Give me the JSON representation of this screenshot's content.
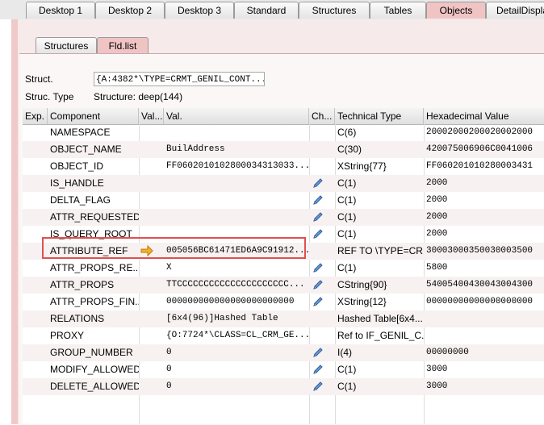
{
  "tabs": [
    {
      "label": "Desktop 1",
      "active": false
    },
    {
      "label": "Desktop 2",
      "active": false
    },
    {
      "label": "Desktop 3",
      "active": false
    },
    {
      "label": "Standard",
      "active": false
    },
    {
      "label": "Structures",
      "active": false
    },
    {
      "label": "Tables",
      "active": false
    },
    {
      "label": "Objects",
      "active": true
    },
    {
      "label": "DetailDisplay",
      "active": false
    }
  ],
  "subtabs": [
    {
      "label": "Structures",
      "active": false
    },
    {
      "label": "Fld.list",
      "active": true
    }
  ],
  "struct": {
    "label": "Struct.",
    "value": "{A:4382*\\TYPE=CRMT_GENIL_CONT...",
    "type_label": "Struc. Type",
    "type_value": "Structure: deep(144)"
  },
  "columns": {
    "exp": "Exp.",
    "component": "Component",
    "valshort": "Val...",
    "val": "Val.",
    "ch": "Ch...",
    "techtype": "Technical Type",
    "hex": "Hexadecimal Value"
  },
  "rows": [
    {
      "component": "NAMESPACE",
      "val": "",
      "changeable": false,
      "arrow": false,
      "techtype": "C(6)",
      "hex": "20002000200020002000"
    },
    {
      "component": "OBJECT_NAME",
      "val": "BuilAddress",
      "changeable": false,
      "arrow": false,
      "techtype": "C(30)",
      "hex": "420075006906C0041006"
    },
    {
      "component": "OBJECT_ID",
      "val": "FF0602010102800034313033...",
      "changeable": false,
      "arrow": false,
      "techtype": "XString{77}",
      "hex": "FF060201010280003431"
    },
    {
      "component": "IS_HANDLE",
      "val": "",
      "changeable": true,
      "arrow": false,
      "techtype": "C(1)",
      "hex": "2000"
    },
    {
      "component": "DELTA_FLAG",
      "val": "",
      "changeable": true,
      "arrow": false,
      "techtype": "C(1)",
      "hex": "2000"
    },
    {
      "component": "ATTR_REQUESTED",
      "val": "",
      "changeable": true,
      "arrow": false,
      "techtype": "C(1)",
      "hex": "2000"
    },
    {
      "component": "IS_QUERY_ROOT",
      "val": "",
      "changeable": true,
      "arrow": false,
      "techtype": "C(1)",
      "hex": "2000"
    },
    {
      "component": "ATTRIBUTE_REF",
      "val": "005056BC61471ED6A9C91912...",
      "changeable": false,
      "arrow": true,
      "techtype": "REF TO \\TYPE=CR...",
      "hex": "30003000350030003500"
    },
    {
      "component": "ATTR_PROPS_RE...",
      "val": "X",
      "changeable": true,
      "arrow": false,
      "techtype": "C(1)",
      "hex": "5800"
    },
    {
      "component": "ATTR_PROPS",
      "val": "TTCCCCCCCCCCCCCCCCCCCCC...",
      "changeable": true,
      "arrow": false,
      "techtype": "CString{90}",
      "hex": "54005400430043004300"
    },
    {
      "component": "ATTR_PROPS_FIN...",
      "val": "000000000000000000000000",
      "changeable": true,
      "arrow": false,
      "techtype": "XString{12}",
      "hex": "00000000000000000000"
    },
    {
      "component": "RELATIONS",
      "val": "[6x4(96)]Hashed Table",
      "changeable": false,
      "arrow": false,
      "techtype": "Hashed Table[6x4...",
      "hex": ""
    },
    {
      "component": "PROXY",
      "val": "{O:7724*\\CLASS=CL_CRM_GE...",
      "changeable": false,
      "arrow": false,
      "techtype": "Ref to IF_GENIL_C...",
      "hex": ""
    },
    {
      "component": "GROUP_NUMBER",
      "val": "0",
      "changeable": true,
      "arrow": false,
      "techtype": "I(4)",
      "hex": "00000000"
    },
    {
      "component": "MODIFY_ALLOWED",
      "val": "0",
      "changeable": true,
      "arrow": false,
      "techtype": "C(1)",
      "hex": "3000"
    },
    {
      "component": "DELETE_ALLOWED",
      "val": "0",
      "changeable": true,
      "arrow": false,
      "techtype": "C(1)",
      "hex": "3000"
    }
  ],
  "colors": {
    "active_tab": "#f1c4c4",
    "highlight": "#e05050",
    "pencil": "#3a6fb0",
    "arrow": "#f0a020"
  }
}
